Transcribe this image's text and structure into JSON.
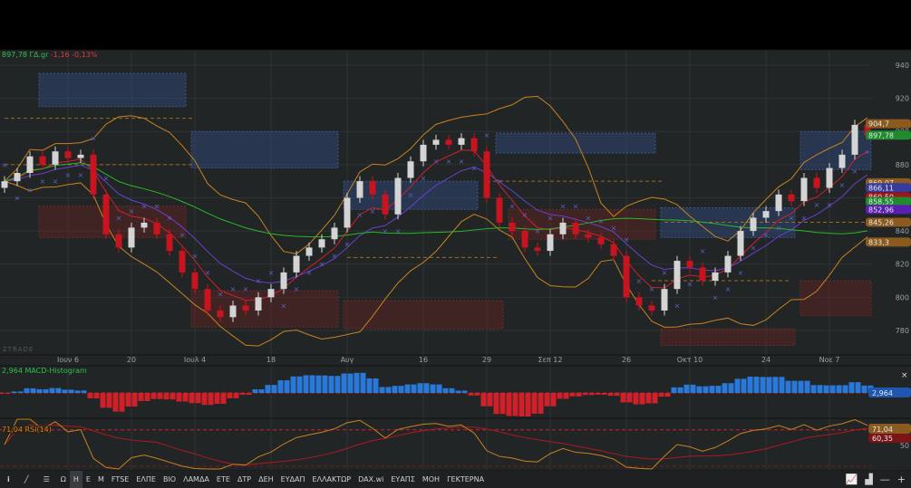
{
  "header": {
    "price": "897,78 ΓΔ.gr",
    "change": "-1,16",
    "change_pct": "-0,13%"
  },
  "watermark": "ZTRADE",
  "toolbar": {
    "items": [
      "Ω",
      "H",
      "E",
      "M",
      "FTSE",
      "ΕΛΠΕ",
      "ΒΙΟ",
      "ΛΑΜΔΑ",
      "ΕΤΕ",
      "ΔΤΡ",
      "ΔΕΗ",
      "ΕΥΔΑΠ",
      "ΕΛΛΑΚΤΩΡ",
      "DAX.wi",
      "ΕΥΑΠΣ",
      "ΜΟΗ",
      "ΓΕΚΤΕΡΝΑ"
    ],
    "active": "H",
    "icons": [
      "info-icon",
      "draw-line-icon",
      "indicators-icon"
    ],
    "right_icons": [
      "chart-type-icon",
      "volume-icon",
      "zoom-out-icon",
      "zoom-in-icon"
    ]
  },
  "macd": {
    "label": "2,964 MACD-Histogram",
    "value": "2,964",
    "close": "×"
  },
  "rsi": {
    "label": "71,04 RSI(14)",
    "value": "71,04",
    "value2": "60,35",
    "level": "50",
    "close": "×"
  },
  "colors": {
    "up": "#d4d4d4",
    "down": "#c8141e",
    "bb": "#c8821e",
    "ema_fast": "#d0202a",
    "ema_slow": "#6a3fd0",
    "sma_long": "#28b828",
    "psar": "#5a5fc8",
    "macd_pos": "#2a78d8",
    "macd_neg": "#d0202a",
    "rsi": "#c8821e"
  },
  "chart_data": {
    "type": "candlestick",
    "y_ticks": [
      940,
      920,
      900,
      880,
      860,
      840,
      820,
      800,
      780
    ],
    "ylim": [
      776,
      946
    ],
    "x_ticks": [
      {
        "label": "Ιουν 6",
        "i": 5
      },
      {
        "label": "20",
        "i": 10
      },
      {
        "label": "Ιουλ 4",
        "i": 15
      },
      {
        "label": "18",
        "i": 21
      },
      {
        "label": "Αυγ",
        "i": 27
      },
      {
        "label": "16",
        "i": 33
      },
      {
        "label": "29",
        "i": 38
      },
      {
        "label": "Σεπ 12",
        "i": 43
      },
      {
        "label": "26",
        "i": 49
      },
      {
        "label": "Οκτ 10",
        "i": 54
      },
      {
        "label": "24",
        "i": 60
      },
      {
        "label": "Νοε 7",
        "i": 65
      }
    ],
    "closes": [
      870,
      875,
      885,
      880,
      888,
      884,
      886,
      862,
      838,
      830,
      842,
      845,
      838,
      828,
      815,
      805,
      792,
      788,
      795,
      792,
      800,
      805,
      815,
      825,
      830,
      835,
      842,
      860,
      870,
      862,
      850,
      872,
      882,
      892,
      895,
      892,
      896,
      888,
      860,
      845,
      840,
      830,
      828,
      838,
      845,
      838,
      836,
      832,
      825,
      800,
      795,
      792,
      805,
      822,
      818,
      810,
      815,
      825,
      840,
      848,
      852,
      862,
      858,
      872,
      866,
      878,
      886,
      904,
      897.78
    ],
    "zones": [
      {
        "type": "supply",
        "from": 3,
        "to": 14,
        "top": 935,
        "bottom": 915
      },
      {
        "type": "supply",
        "from": 15,
        "to": 26,
        "top": 900,
        "bottom": 878
      },
      {
        "type": "supply",
        "from": 27,
        "to": 37,
        "top": 870,
        "bottom": 853
      },
      {
        "type": "supply",
        "from": 39,
        "to": 51,
        "top": 899,
        "bottom": 887
      },
      {
        "type": "supply",
        "from": 52,
        "to": 62,
        "top": 854,
        "bottom": 836
      },
      {
        "type": "supply",
        "from": 63,
        "to": 68,
        "top": 900,
        "bottom": 877
      },
      {
        "type": "demand",
        "from": 3,
        "to": 14,
        "top": 855,
        "bottom": 836
      },
      {
        "type": "demand",
        "from": 15,
        "to": 26,
        "top": 804,
        "bottom": 782
      },
      {
        "type": "demand",
        "from": 27,
        "to": 39,
        "top": 798,
        "bottom": 781
      },
      {
        "type": "demand",
        "from": 40,
        "to": 51,
        "top": 853,
        "bottom": 835
      },
      {
        "type": "demand",
        "from": 52,
        "to": 62,
        "top": 781,
        "bottom": 771
      },
      {
        "type": "demand",
        "from": 63,
        "to": 68,
        "top": 810,
        "bottom": 789
      }
    ],
    "levels": [
      {
        "price": 908,
        "to": 15
      },
      {
        "price": 880,
        "to": 15
      },
      {
        "price": 870,
        "from": 38,
        "to": 52
      },
      {
        "price": 845.26,
        "from": 52,
        "to": 68
      },
      {
        "price": 824,
        "from": 27,
        "to": 39
      },
      {
        "price": 810,
        "from": 51,
        "to": 62
      }
    ],
    "price_labels": [
      {
        "text": "904,7",
        "price": 904.7,
        "color": "#8a5a1e"
      },
      {
        "text": "897,78",
        "price": 897.78,
        "color": "#1f8a2e"
      },
      {
        "text": "869,07",
        "price": 869.07,
        "color": "#8a5a1e"
      },
      {
        "text": "866,11",
        "price": 866.11,
        "color": "#3a3a9a"
      },
      {
        "text": "860,50",
        "price": 860.5,
        "color": "#a0141c"
      },
      {
        "text": "858,55",
        "price": 857.8,
        "color": "#1f8a2e"
      },
      {
        "text": "852,96",
        "price": 852.96,
        "color": "#5a1eb0"
      },
      {
        "text": "845,26",
        "price": 845.26,
        "color": "#8a5a1e"
      },
      {
        "text": "833,3",
        "price": 833.3,
        "color": "#8a5a1e"
      }
    ]
  }
}
